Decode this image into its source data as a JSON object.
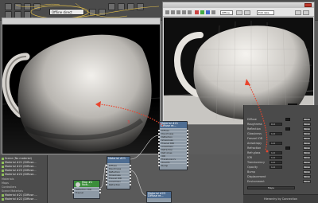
{
  "toolbar": {
    "render_preset": "Offline direct"
  },
  "render_window": {
    "badge": "3"
  },
  "active_window": {
    "preset": "Offline",
    "field": "Edit data"
  },
  "material_list": {
    "items": [
      "Scene (No material)",
      "Material #21 (Diffuse...",
      "Material #22 (Diffuse...",
      "Material #23 (Diffuse...",
      "Material #24 (Diffuse...",
      "Materials",
      "Maps",
      "Controllers",
      "Scene Materials",
      "Material #21 (Diffuse ...",
      "Material #22 (Diffuse ...",
      "Material #23 (Diffuse ...",
      "Material #24 (Diffuse ..."
    ]
  },
  "nodes": {
    "diffuse_main": {
      "title": "Material #21",
      "subtitle": "Diffuse re...",
      "rows": [
        "Diffuse",
        "Roughness",
        "Reflection",
        "Glossiness",
        "Fresnel IOR",
        "Anisotropy",
        "Refraction",
        "Refr.gloss",
        "IOR",
        "Translucency",
        "Opacity",
        "Bump",
        "Displacement",
        "Environment"
      ]
    },
    "diffuse_top": {
      "title": "Material #21",
      "subtitle": "Diffuse re...",
      "rows": [
        "Diffuse",
        "Roughness",
        "Reflection",
        "Glossiness",
        "Fresnel IOR",
        "Anisotropy",
        "Refraction",
        "Refr.gloss",
        "IOR",
        "Translucency",
        "Opacity",
        "Bump",
        "Displacement",
        "Environment"
      ]
    },
    "blend_node": {
      "title": "Map #1",
      "subtitle": "Mask",
      "rows": [
        "Diffuse IOR",
        "Reflection",
        "Glossiness"
      ]
    },
    "green_node": {
      "title": "Map #1",
      "subtitle": "Nois...",
      "rows": [
        "Reflection IOR",
        "Fresnel"
      ]
    },
    "bottom_node": {
      "title": "Material #23",
      "subtitle": "Diffuse re..."
    }
  },
  "params": {
    "rows": [
      {
        "label": "Diffuse",
        "value": "1.0",
        "btn": "None"
      },
      {
        "label": "Roughness",
        "value": "0.0",
        "btn": "None"
      },
      {
        "label": "Reflection",
        "value": "1.0",
        "btn": "None"
      },
      {
        "label": "Glossiness",
        "value": "1.0",
        "btn": "None"
      },
      {
        "label": "Fresnel IOR",
        "value": "",
        "btn": "None"
      },
      {
        "label": "Anisotropy",
        "value": "1.0",
        "btn": "None"
      },
      {
        "label": "Refraction",
        "value": "1.0",
        "btn": "None"
      },
      {
        "label": "Refr.gloss",
        "value": "1.0",
        "btn": "None"
      },
      {
        "label": "IOR",
        "value": "1.0",
        "btn": "None"
      },
      {
        "label": "Translucency",
        "value": "1.0",
        "btn": "None"
      },
      {
        "label": "Opacity",
        "value": "1.0",
        "btn": "None"
      },
      {
        "label": "Bump",
        "value": "",
        "btn": "None"
      },
      {
        "label": "Displacement",
        "value": "",
        "btn": "None"
      },
      {
        "label": "Environment",
        "value": "",
        "btn": "None"
      }
    ],
    "map_bar": "Maps",
    "footer": "Hierarchy by Connection"
  },
  "colors": {
    "arrow": "#e8452e",
    "node_header": "#4e6d92",
    "node_body": "#8e9aa6"
  }
}
